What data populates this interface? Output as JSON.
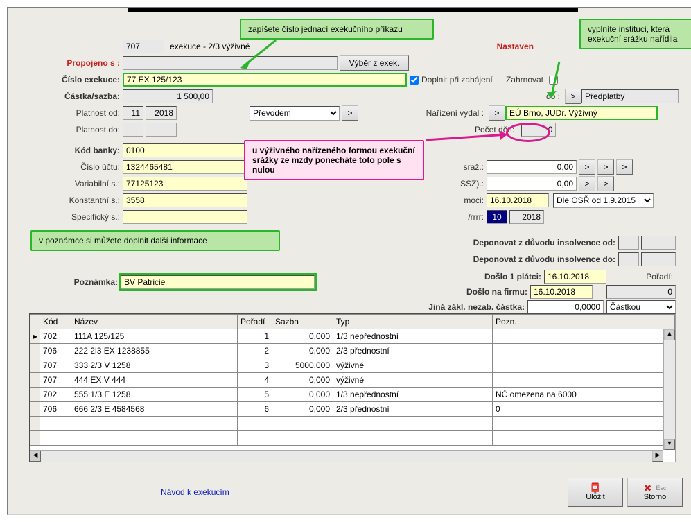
{
  "header": {
    "code": "707",
    "title_prefix": "exekuce - 2",
    "title_suffix": "3 výživné",
    "nastaveni": "Nastaven"
  },
  "callouts": {
    "top": "zapíšete číslo jednací exekučního příkazu",
    "right": "vyplníte instituci, která exekuční srážku nařídila",
    "pink": "u výživného nařízeného formou exekuční srážky ze mzdy ponecháte toto pole s nulou",
    "note": "v poznámce si můžete doplnit další informace"
  },
  "labels": {
    "propojeno": "Propojeno s :",
    "vyber": "Výběr z exek.",
    "cislo_exekuce": "Číslo exekuce:",
    "castka": "Částka/sazba:",
    "doplnit": "Doplnit při zahájení",
    "zahrnovat": "Zahrnovat",
    "do": "do :",
    "platnost_od": "Platnost od:",
    "platnost_do": "Platnost do:",
    "narizeni": "Nařízení vydal :",
    "pocet_deti": "Počet dě",
    "pocet_deti2": "tí:",
    "kod_banky": "Kód banky:",
    "cislo_uctu": "Číslo účtu:",
    "variabilni": "Variabilní s.:",
    "konstantni": "Konstantní s.:",
    "specificky": "Specifický s.:",
    "poznamka": "Poznámka:",
    "sraz": "sraž.:",
    "ssz": "SSZ).:",
    "moci": "moci:",
    "n_rrrr": "/rrrr:",
    "deponovat_od": "Deponovat z důvodu insolvence od:",
    "deponovat_do": "Deponovat z důvodu insolvence do:",
    "doslo_platci": "Došlo 1 plátci:",
    "doslo_firmu": "Došlo na firmu:",
    "jina_zakl": "Jiná zákl. nezab. částka:",
    "poradi": "Pořadí:"
  },
  "values": {
    "propojeno": "",
    "cislo_exekuce": "77 EX 125/123",
    "castka": "1 500,00",
    "platnost_od_m": "11",
    "platnost_od_r": "2018",
    "zpusob": "Převodem",
    "predplatby": "Předplatby",
    "narizeni": "EÚ Brno, JUDr. Výživný",
    "pocet_deti": "0",
    "kod_banky": "0100",
    "cislo_uctu": "1324465481",
    "variabilni": "77125123",
    "konstantni": "3558",
    "specificky": "",
    "poznamka": "BV Patricie",
    "sraz": "0,00",
    "ssz": "0,00",
    "moci": "16.10.2018",
    "osr": "Dle OSŘ od 1.9.2015",
    "n_m": "10",
    "n_r": "2018",
    "doslo_platci": "16.10.2018",
    "doslo_firmu": "16.10.2018",
    "jina_zakl": "0,0000",
    "castkou": "Částkou",
    "poradi_val": "0"
  },
  "table": {
    "headers": {
      "kod": "Kód",
      "nazev": "Název",
      "poradi": "Pořadí",
      "sazba": "Sazba",
      "typ": "Typ",
      "pozn": "Pozn."
    },
    "rows": [
      {
        "kod": "702",
        "nazev": "111A 125/125",
        "poradi": "1",
        "sazba": "0,000",
        "typ": "1/3 nepřednostní",
        "pozn": ""
      },
      {
        "kod": "706",
        "nazev": "222 2l3 EX 1238855",
        "poradi": "2",
        "sazba": "0,000",
        "typ": "2/3 přednostní",
        "pozn": ""
      },
      {
        "kod": "707",
        "nazev": "333 2/3 V 1258",
        "poradi": "3",
        "sazba": "5000,000",
        "typ": "výživné",
        "pozn": ""
      },
      {
        "kod": "707",
        "nazev": "444 EX V 444",
        "poradi": "4",
        "sazba": "0,000",
        "typ": "výživné",
        "pozn": ""
      },
      {
        "kod": "702",
        "nazev": "555 1/3 E 1258",
        "poradi": "5",
        "sazba": "0,000",
        "typ": "1/3 nepřednostní",
        "pozn": "NČ omezena na 6000"
      },
      {
        "kod": "706",
        "nazev": "666 2/3 E 4584568",
        "poradi": "6",
        "sazba": "0,000",
        "typ": "2/3 přednostní",
        "pozn": "0"
      }
    ]
  },
  "footer": {
    "link": "Návod k exekucím",
    "save": "Uložit",
    "cancel": "Storno",
    "esc": "Esc"
  }
}
